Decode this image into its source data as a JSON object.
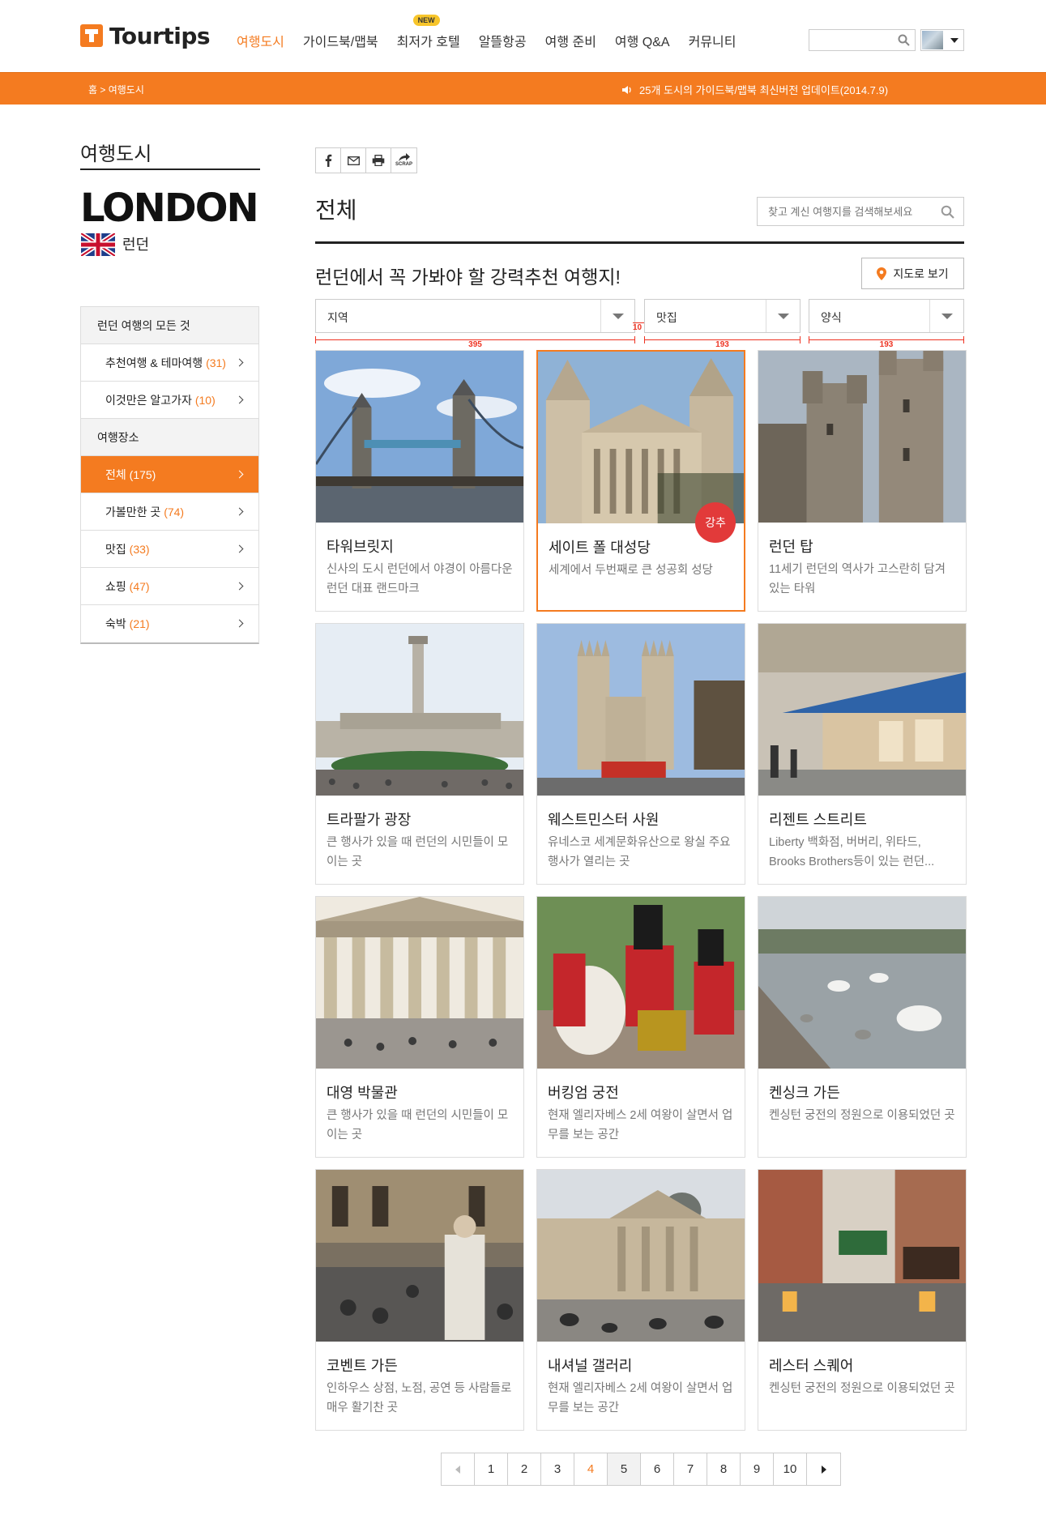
{
  "header": {
    "logo_text": "Tourtips",
    "nav": [
      {
        "label": "여행도시",
        "active": true,
        "new": false
      },
      {
        "label": "가이드북/맵북",
        "active": false,
        "new": false
      },
      {
        "label": "최저가 호텔",
        "active": false,
        "new": true
      },
      {
        "label": "알뜰항공",
        "active": false,
        "new": false
      },
      {
        "label": "여행 준비",
        "active": false,
        "new": false
      },
      {
        "label": "여행 Q&A",
        "active": false,
        "new": false
      },
      {
        "label": "커뮤니티",
        "active": false,
        "new": false
      }
    ],
    "new_badge": "NEW",
    "search_placeholder": ""
  },
  "subbar": {
    "breadcrumb": "홈 > 여행도시",
    "notice": "25개 도시의 가이드북/맵북 최신버전 업데이트(2014.7.9)"
  },
  "sidebar": {
    "title": "여행도시",
    "city_en": "LONDON",
    "city_ko": "런던",
    "items": [
      {
        "kind": "sec",
        "label": "런던 여행의 모든 것"
      },
      {
        "kind": "it",
        "label": "추천여행 & 테마여행",
        "count": "(31)",
        "on": false
      },
      {
        "kind": "it",
        "label": "이것만은 알고가자",
        "count": "(10)",
        "on": false
      },
      {
        "kind": "sec",
        "label": "여행장소"
      },
      {
        "kind": "it",
        "label": "전체",
        "count": "(175)",
        "on": true
      },
      {
        "kind": "it",
        "label": "가볼만한 곳",
        "count": "(74)",
        "on": false
      },
      {
        "kind": "it",
        "label": "맛집",
        "count": "(33)",
        "on": false
      },
      {
        "kind": "it",
        "label": "쇼핑",
        "count": "(47)",
        "on": false
      },
      {
        "kind": "it",
        "label": "숙박",
        "count": "(21)",
        "on": false
      }
    ]
  },
  "main": {
    "share_scrap": "SCRAP",
    "title": "전체",
    "search_placeholder": "찾고 계신 여행지를 검색해보세요",
    "subtitle": "런던에서 꼭 가봐야 할 강력추천 여행지!",
    "map_button": "지도로 보기",
    "filters": [
      "지역",
      "맛집",
      "양식"
    ],
    "dimension_labels": {
      "first": "395",
      "gap": "10",
      "second": "193",
      "third": "193"
    },
    "recommend_badge": "강추",
    "cards": [
      {
        "title": "타워브릿지",
        "desc": "신사의 도시 런던에서 야경이 아름다운 런던 대표 랜드마크",
        "scene": "bridge",
        "selected": false
      },
      {
        "title": "세이트 폴 대성당",
        "desc": "세계에서 두번째로 큰 성공회 성당",
        "scene": "cathedral",
        "selected": true
      },
      {
        "title": "런던 탑",
        "desc": "11세기 런던의 역사가 고스란히 담겨 있는 타워",
        "scene": "tower",
        "selected": false
      },
      {
        "title": "트라팔가 광장",
        "desc": "큰 행사가 있을 때 런던의 시민들이 모이는 곳",
        "scene": "square",
        "selected": false
      },
      {
        "title": "웨스트민스터 사원",
        "desc": "유네스코 세계문화유산으로 왕실 주요 행사가 열리는 곳",
        "scene": "abbey",
        "selected": false
      },
      {
        "title": "리젠트 스트리트",
        "desc": "Liberty 백화점, 버버리, 위타드, Brooks Brothers등이 있는 런던...",
        "scene": "street",
        "selected": false
      },
      {
        "title": "대영 박물관",
        "desc": "큰 행사가 있을 때 런던의 시민들이 모이는 곳",
        "scene": "museum",
        "selected": false
      },
      {
        "title": "버킹엄 궁전",
        "desc": "현재 엘리자베스 2세 여왕이 살면서 업무를 보는 공간",
        "scene": "guards",
        "selected": false
      },
      {
        "title": "켄싱크 가든",
        "desc": "켄싱턴 궁전의 정원으로 이용되었던 곳",
        "scene": "garden",
        "selected": false
      },
      {
        "title": "코벤트 가든",
        "desc": "인하우스 상점, 노점, 공연 등 사람들로 매우 활기찬 곳",
        "scene": "covent",
        "selected": false
      },
      {
        "title": "내셔널 갤러리",
        "desc": "현재 엘리자베스 2세 여왕이 살면서 업무를 보는 공간",
        "scene": "gallery",
        "selected": false
      },
      {
        "title": "레스터 스퀘어",
        "desc": "켄싱턴 궁전의 정원으로 이용되었던 곳",
        "scene": "leicester",
        "selected": false
      }
    ]
  },
  "pager": {
    "pages": [
      "1",
      "2",
      "3",
      "4",
      "5",
      "6",
      "7",
      "8",
      "9",
      "10"
    ],
    "current": "4",
    "highlighted": "5"
  },
  "colors": {
    "accent": "#f47b20",
    "badge": "#e23a3a",
    "dimension": "#e32222"
  }
}
